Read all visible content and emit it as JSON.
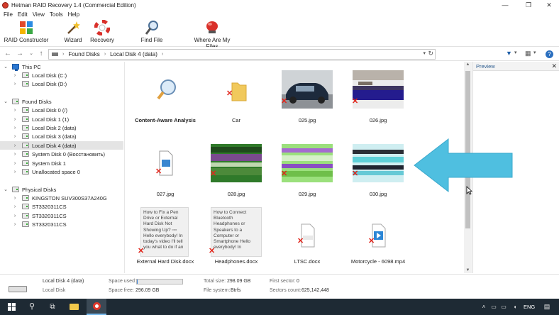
{
  "window": {
    "title": "Hetman RAID Recovery 1.4 (Commercial Edition)",
    "controls": [
      "—",
      "❐",
      "✕"
    ]
  },
  "menu": [
    "File",
    "Edit",
    "View",
    "Tools",
    "Help"
  ],
  "ribbon": {
    "raid_constructor": "RAID Constructor",
    "wizard": "Wizard",
    "recovery": "Recovery",
    "find_file": "Find File",
    "where_are_my_files": "Where Are My Files"
  },
  "address": {
    "segments": [
      "Found Disks",
      "Local Disk 4 (data)"
    ]
  },
  "tree": {
    "this_pc": "This PC",
    "this_pc_items": [
      "Local Disk (C:)",
      "Local Disk (D:)"
    ],
    "found_disks": "Found Disks",
    "found_items": [
      "Local Disk 0 (/)",
      "Local Disk 1 (1)",
      "Local Disk 2 (data)",
      "Local Disk 3 (data)",
      "Local Disk 4 (data)",
      "System Disk 0 (Восстановить)",
      "System Disk 1",
      "Unallocated space 0"
    ],
    "physical_disks": "Physical Disks",
    "physical_items": [
      "KINGSTON SUV300S37A240G",
      "ST3320311CS",
      "ST3320311CS",
      "ST3320311CS"
    ]
  },
  "files": {
    "row1": [
      "Content-Aware Analysis",
      "Car",
      "025.jpg",
      "026.jpg"
    ],
    "row2": [
      "027.jpg",
      "028.jpg",
      "029.jpg",
      "030.jpg"
    ],
    "row3": [
      "External Hard Disk.docx",
      "Headphones.docx",
      "LTSC.docx",
      "Motorcycle - 6098.mp4"
    ]
  },
  "doc_previews": {
    "external": "How to Fix a Pen Drive or External Hard Disk Not Showing Up? ▫▫▫ Hello everybody! In today's video I'll tell you what to do if an",
    "headphones": "How to Connect Bluetooth Headphones or Speakers to a Computer or Smartphone Hello everybody! In"
  },
  "preview": {
    "title": "Preview",
    "close": "✕"
  },
  "status": {
    "disk_name": "Local Disk 4 (data)",
    "disk_type": "Local Disk",
    "space_used_label": "Space used:",
    "space_free_label": "Space free:",
    "space_free": "296.09 GB",
    "total_size_label": "Total size:",
    "total_size": "298.09 GB",
    "file_system_label": "File system:",
    "file_system": "Btrfs",
    "first_sector_label": "First sector:",
    "first_sector": "0",
    "sectors_count_label": "Sectors count:",
    "sectors_count": "625,142,448",
    "space_used_fraction": 0.01
  },
  "taskbar": {
    "lang": "ENG"
  }
}
